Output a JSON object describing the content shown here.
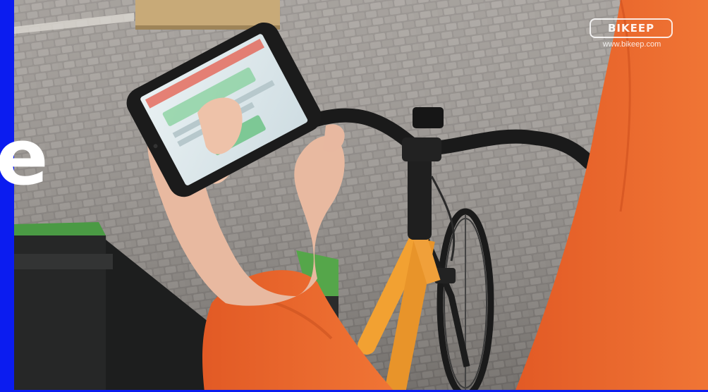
{
  "overlay": {
    "partial_letter": "e",
    "accent_color": "#0b1cf0"
  },
  "logo": {
    "wordmark": "BIKEEP",
    "url": "www.bikeep.com"
  }
}
